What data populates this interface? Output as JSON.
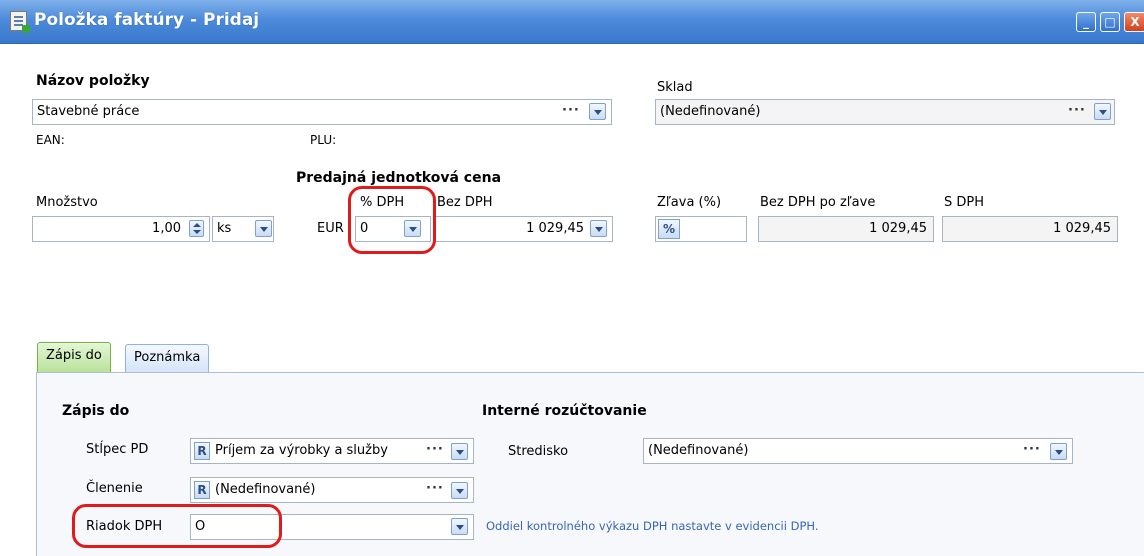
{
  "window": {
    "title": "Položka faktúry - Pridaj",
    "buttons": {
      "minimize": "_",
      "maximize": "□",
      "close": "X"
    }
  },
  "item": {
    "name_label": "Názov položky",
    "name_value": "Stavebné práce",
    "ean_label": "EAN:",
    "plu_label": "PLU:"
  },
  "warehouse": {
    "label": "Sklad",
    "value": "(Nedefinované)"
  },
  "price": {
    "section_title": "Predajná jednotková cena",
    "quantity_label": "Množstvo",
    "quantity_value": "1,00",
    "unit_value": "ks",
    "currency_label": "EUR",
    "vat_label": "% DPH",
    "vat_value": "0",
    "without_vat_label": "Bez DPH",
    "without_vat_value": "1 029,45",
    "discount_label": "Zľava (%)",
    "discount_button": "%",
    "after_discount_label": "Bez DPH po zľave",
    "after_discount_value": "1 029,45",
    "with_vat_label": "S DPH",
    "with_vat_value": "1 029,45"
  },
  "tabs": [
    {
      "label": "Zápis do",
      "active": true
    },
    {
      "label": "Poznámka",
      "active": false
    }
  ],
  "entry": {
    "section_title": "Zápis do",
    "column_label": "Stĺpec PD",
    "column_badge": "R",
    "column_value": "Príjem za výrobky a služby",
    "division_label": "Členenie",
    "division_badge": "R",
    "division_value": "(Nedefinované)",
    "vat_row_label": "Riadok DPH",
    "vat_row_value": "O",
    "vat_note": "Oddiel kontrolného výkazu DPH nastavte v evidencii DPH."
  },
  "internal": {
    "section_title": "Interné rozúčtovanie",
    "center_label": "Stredisko",
    "center_value": "(Nedefinované)"
  },
  "colors": {
    "titlebar": "#3a78cc",
    "annotation": "#e01b1b",
    "note": "#3865b9",
    "active_tab": "#b9e29a"
  }
}
